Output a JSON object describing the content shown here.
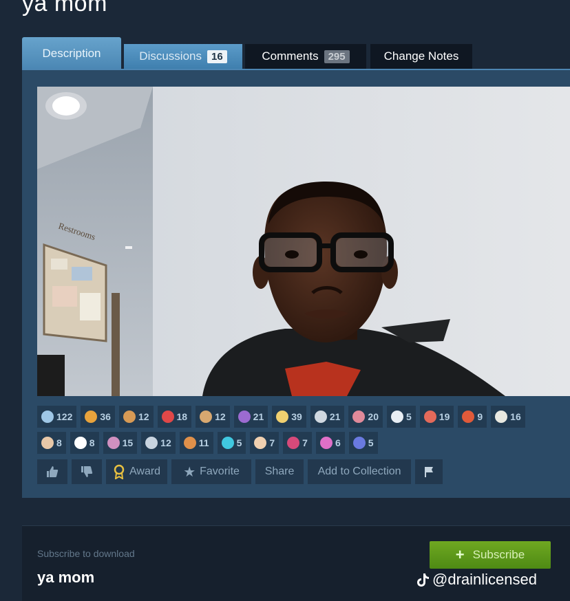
{
  "page": {
    "title": "ya mom"
  },
  "tabs": [
    {
      "label": "Description"
    },
    {
      "label": "Discussions",
      "count": "16"
    },
    {
      "label": "Comments",
      "count": "295"
    },
    {
      "label": "Change Notes"
    }
  ],
  "reactions": {
    "row1": [
      {
        "icon": "horns-icon",
        "count": "122",
        "color": "#9fc7e6"
      },
      {
        "icon": "pointing-hand-icon",
        "count": "36",
        "color": "#e8a33c"
      },
      {
        "icon": "cookie-face-icon",
        "count": "12",
        "color": "#d79a55"
      },
      {
        "icon": "small-red-icon",
        "count": "18",
        "color": "#e04848"
      },
      {
        "icon": "figure-icon",
        "count": "12",
        "color": "#d8a870"
      },
      {
        "icon": "purple-blob-icon",
        "count": "21",
        "color": "#9c6bd1"
      },
      {
        "icon": "sparkle-icon",
        "count": "39",
        "color": "#f0d070"
      },
      {
        "icon": "boot-icon",
        "count": "21",
        "color": "#d0d8e0"
      },
      {
        "icon": "pig-icon",
        "count": "20",
        "color": "#e08a9a"
      },
      {
        "icon": "cloud-icon",
        "count": "5",
        "color": "#e8eef4"
      },
      {
        "icon": "monster-face-icon",
        "count": "19",
        "color": "#e46a5a"
      },
      {
        "icon": "rocket-icon",
        "count": "9",
        "color": "#e05a3a"
      },
      {
        "icon": "mummy-icon",
        "count": "16",
        "color": "#e8e8e0"
      }
    ],
    "row2": [
      {
        "icon": "baby-face-icon",
        "count": "8",
        "color": "#e8c8a8"
      },
      {
        "icon": "eye-icon",
        "count": "8",
        "color": "#ffffff"
      },
      {
        "icon": "eyes-icon",
        "count": "15",
        "color": "#d090c0"
      },
      {
        "icon": "helmet-icon",
        "count": "12",
        "color": "#c8d4e0"
      },
      {
        "icon": "character-icon",
        "count": "11",
        "color": "#e0904a"
      },
      {
        "icon": "flashlight-icon",
        "count": "5",
        "color": "#40c8e0"
      },
      {
        "icon": "clown-icon",
        "count": "7",
        "color": "#f0d0b0"
      },
      {
        "icon": "crab-icon",
        "count": "7",
        "color": "#d64a7a"
      },
      {
        "icon": "flower-blob-icon",
        "count": "6",
        "color": "#e070c8"
      },
      {
        "icon": "blue-creature-icon",
        "count": "5",
        "color": "#6a7ae0"
      }
    ]
  },
  "actions": {
    "thumbs_up_icon": "thumbs-up-icon",
    "thumbs_down_icon": "thumbs-down-icon",
    "award_label": "Award",
    "favorite_label": "Favorite",
    "share_label": "Share",
    "add_collection_label": "Add to Collection",
    "flag_icon": "flag-icon"
  },
  "subscribe": {
    "label": "Subscribe to download",
    "title": "ya mom",
    "button_label": "Subscribe"
  },
  "watermark": {
    "text": "@drainlicensed"
  },
  "photo": {
    "sign_text": "Restrooms"
  }
}
